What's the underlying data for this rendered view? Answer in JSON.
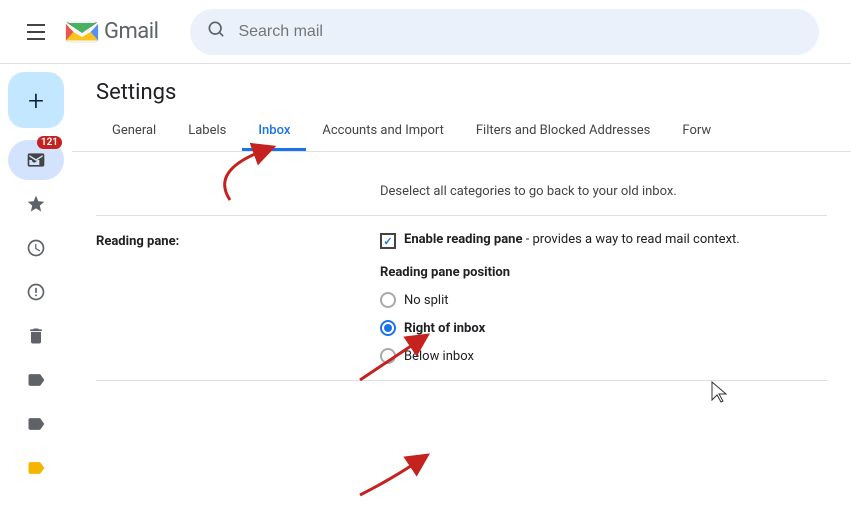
{
  "header": {
    "search_placeholder": "Search mail",
    "gmail_label": "Gmail",
    "menu_icon": "hamburger-icon"
  },
  "sidebar": {
    "compose_label": "+",
    "badge_count": "121",
    "icons": [
      {
        "name": "inbox-icon",
        "symbol": "📥",
        "active": true,
        "badge": "121"
      },
      {
        "name": "star-icon",
        "symbol": "★",
        "active": false
      },
      {
        "name": "clock-icon",
        "symbol": "🕐",
        "active": false
      },
      {
        "name": "exclamation-icon",
        "symbol": "!",
        "active": false
      },
      {
        "name": "trash-icon",
        "symbol": "🗑",
        "active": false
      },
      {
        "name": "label1-icon",
        "symbol": "🏷",
        "active": false
      },
      {
        "name": "label2-icon",
        "symbol": "🏷",
        "active": false
      },
      {
        "name": "label3-icon",
        "symbol": "🏷",
        "active": false,
        "color": "gold"
      }
    ]
  },
  "settings": {
    "title": "Settings",
    "tabs": [
      {
        "label": "General",
        "active": false
      },
      {
        "label": "Labels",
        "active": false
      },
      {
        "label": "Inbox",
        "active": true
      },
      {
        "label": "Accounts and Import",
        "active": false
      },
      {
        "label": "Filters and Blocked Addresses",
        "active": false
      },
      {
        "label": "Forw",
        "active": false
      }
    ],
    "rows": [
      {
        "id": "categories",
        "label": "",
        "text": "Deselect all categories to go back to your old inbox."
      },
      {
        "id": "reading-pane",
        "label": "Reading pane:",
        "enable_checkbox_checked": true,
        "enable_label_bold": "Enable reading pane",
        "enable_label_rest": " - provides a way to read mail context.",
        "position_title": "Reading pane position",
        "options": [
          {
            "label": "No split",
            "selected": false
          },
          {
            "label": "Right of inbox",
            "selected": true
          },
          {
            "label": "Below inbox",
            "selected": false
          }
        ]
      }
    ]
  }
}
